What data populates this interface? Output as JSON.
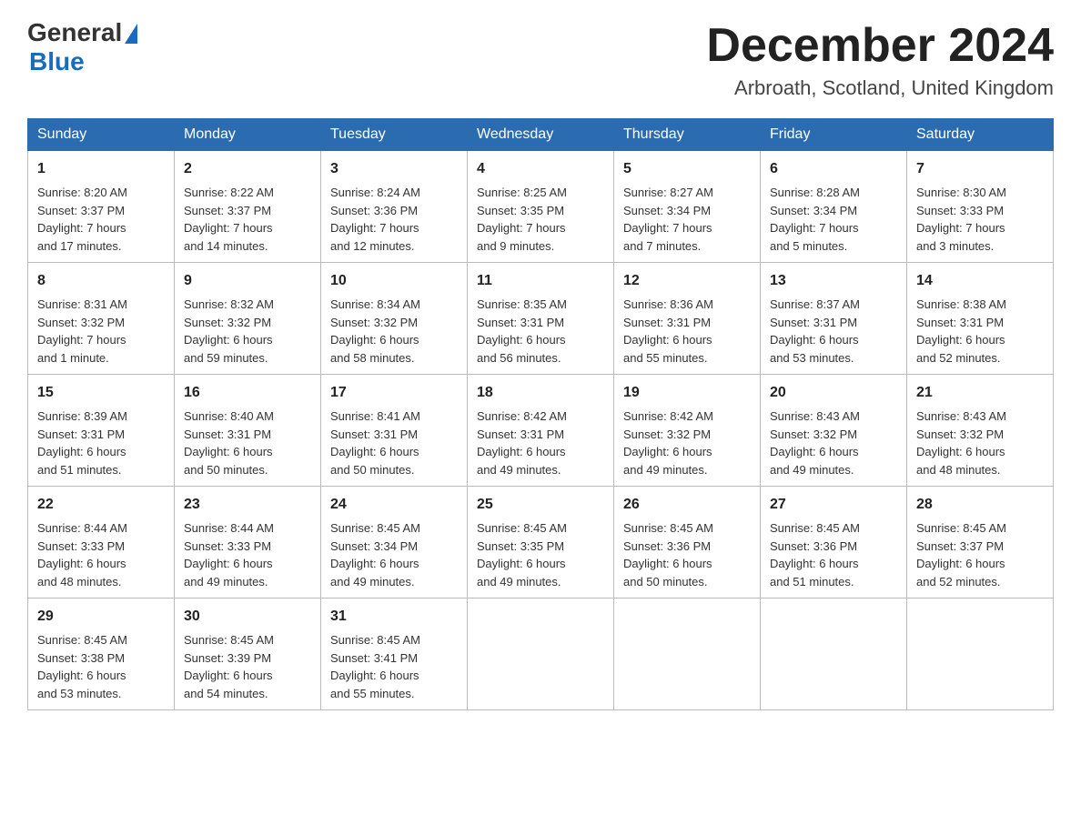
{
  "header": {
    "logo": {
      "general": "General",
      "blue": "Blue"
    },
    "title": "December 2024",
    "subtitle": "Arbroath, Scotland, United Kingdom"
  },
  "days": [
    "Sunday",
    "Monday",
    "Tuesday",
    "Wednesday",
    "Thursday",
    "Friday",
    "Saturday"
  ],
  "weeks": [
    [
      {
        "day": "1",
        "sunrise": "8:20 AM",
        "sunset": "3:37 PM",
        "daylight": "7 hours",
        "daylight2": "and 17 minutes."
      },
      {
        "day": "2",
        "sunrise": "8:22 AM",
        "sunset": "3:37 PM",
        "daylight": "7 hours",
        "daylight2": "and 14 minutes."
      },
      {
        "day": "3",
        "sunrise": "8:24 AM",
        "sunset": "3:36 PM",
        "daylight": "7 hours",
        "daylight2": "and 12 minutes."
      },
      {
        "day": "4",
        "sunrise": "8:25 AM",
        "sunset": "3:35 PM",
        "daylight": "7 hours",
        "daylight2": "and 9 minutes."
      },
      {
        "day": "5",
        "sunrise": "8:27 AM",
        "sunset": "3:34 PM",
        "daylight": "7 hours",
        "daylight2": "and 7 minutes."
      },
      {
        "day": "6",
        "sunrise": "8:28 AM",
        "sunset": "3:34 PM",
        "daylight": "7 hours",
        "daylight2": "and 5 minutes."
      },
      {
        "day": "7",
        "sunrise": "8:30 AM",
        "sunset": "3:33 PM",
        "daylight": "7 hours",
        "daylight2": "and 3 minutes."
      }
    ],
    [
      {
        "day": "8",
        "sunrise": "8:31 AM",
        "sunset": "3:32 PM",
        "daylight": "7 hours",
        "daylight2": "and 1 minute."
      },
      {
        "day": "9",
        "sunrise": "8:32 AM",
        "sunset": "3:32 PM",
        "daylight": "6 hours",
        "daylight2": "and 59 minutes."
      },
      {
        "day": "10",
        "sunrise": "8:34 AM",
        "sunset": "3:32 PM",
        "daylight": "6 hours",
        "daylight2": "and 58 minutes."
      },
      {
        "day": "11",
        "sunrise": "8:35 AM",
        "sunset": "3:31 PM",
        "daylight": "6 hours",
        "daylight2": "and 56 minutes."
      },
      {
        "day": "12",
        "sunrise": "8:36 AM",
        "sunset": "3:31 PM",
        "daylight": "6 hours",
        "daylight2": "and 55 minutes."
      },
      {
        "day": "13",
        "sunrise": "8:37 AM",
        "sunset": "3:31 PM",
        "daylight": "6 hours",
        "daylight2": "and 53 minutes."
      },
      {
        "day": "14",
        "sunrise": "8:38 AM",
        "sunset": "3:31 PM",
        "daylight": "6 hours",
        "daylight2": "and 52 minutes."
      }
    ],
    [
      {
        "day": "15",
        "sunrise": "8:39 AM",
        "sunset": "3:31 PM",
        "daylight": "6 hours",
        "daylight2": "and 51 minutes."
      },
      {
        "day": "16",
        "sunrise": "8:40 AM",
        "sunset": "3:31 PM",
        "daylight": "6 hours",
        "daylight2": "and 50 minutes."
      },
      {
        "day": "17",
        "sunrise": "8:41 AM",
        "sunset": "3:31 PM",
        "daylight": "6 hours",
        "daylight2": "and 50 minutes."
      },
      {
        "day": "18",
        "sunrise": "8:42 AM",
        "sunset": "3:31 PM",
        "daylight": "6 hours",
        "daylight2": "and 49 minutes."
      },
      {
        "day": "19",
        "sunrise": "8:42 AM",
        "sunset": "3:32 PM",
        "daylight": "6 hours",
        "daylight2": "and 49 minutes."
      },
      {
        "day": "20",
        "sunrise": "8:43 AM",
        "sunset": "3:32 PM",
        "daylight": "6 hours",
        "daylight2": "and 49 minutes."
      },
      {
        "day": "21",
        "sunrise": "8:43 AM",
        "sunset": "3:32 PM",
        "daylight": "6 hours",
        "daylight2": "and 48 minutes."
      }
    ],
    [
      {
        "day": "22",
        "sunrise": "8:44 AM",
        "sunset": "3:33 PM",
        "daylight": "6 hours",
        "daylight2": "and 48 minutes."
      },
      {
        "day": "23",
        "sunrise": "8:44 AM",
        "sunset": "3:33 PM",
        "daylight": "6 hours",
        "daylight2": "and 49 minutes."
      },
      {
        "day": "24",
        "sunrise": "8:45 AM",
        "sunset": "3:34 PM",
        "daylight": "6 hours",
        "daylight2": "and 49 minutes."
      },
      {
        "day": "25",
        "sunrise": "8:45 AM",
        "sunset": "3:35 PM",
        "daylight": "6 hours",
        "daylight2": "and 49 minutes."
      },
      {
        "day": "26",
        "sunrise": "8:45 AM",
        "sunset": "3:36 PM",
        "daylight": "6 hours",
        "daylight2": "and 50 minutes."
      },
      {
        "day": "27",
        "sunrise": "8:45 AM",
        "sunset": "3:36 PM",
        "daylight": "6 hours",
        "daylight2": "and 51 minutes."
      },
      {
        "day": "28",
        "sunrise": "8:45 AM",
        "sunset": "3:37 PM",
        "daylight": "6 hours",
        "daylight2": "and 52 minutes."
      }
    ],
    [
      {
        "day": "29",
        "sunrise": "8:45 AM",
        "sunset": "3:38 PM",
        "daylight": "6 hours",
        "daylight2": "and 53 minutes."
      },
      {
        "day": "30",
        "sunrise": "8:45 AM",
        "sunset": "3:39 PM",
        "daylight": "6 hours",
        "daylight2": "and 54 minutes."
      },
      {
        "day": "31",
        "sunrise": "8:45 AM",
        "sunset": "3:41 PM",
        "daylight": "6 hours",
        "daylight2": "and 55 minutes."
      },
      null,
      null,
      null,
      null
    ]
  ]
}
